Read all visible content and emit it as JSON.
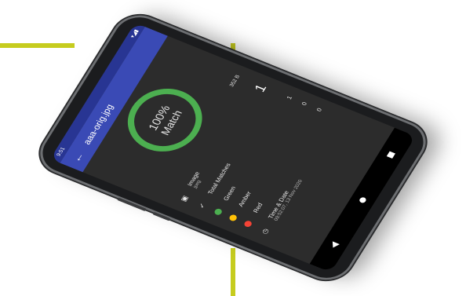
{
  "status_bar": {
    "time": "9:51",
    "icons": "▾◢▮"
  },
  "app_bar": {
    "title": "aaa-orig.jpg"
  },
  "match": {
    "percent": "100%",
    "label": "Match",
    "ring_color": "#4caf50"
  },
  "file_size": "352 B",
  "image_row": {
    "label": "Image",
    "sub": "jpeg"
  },
  "total_matches": {
    "label": "Total Matches",
    "value": "1"
  },
  "green": {
    "label": "Green",
    "value": "1",
    "color": "#4caf50"
  },
  "amber": {
    "label": "Amber",
    "value": "0",
    "color": "#ffc107"
  },
  "red": {
    "label": "Red",
    "value": "0",
    "color": "#f44336"
  },
  "time_date": {
    "label": "Time & Date",
    "value": "09:52:07, 13 Nov 2020"
  },
  "accent_color": "#c6cc1f",
  "appbar_color": "#3a4ab5"
}
